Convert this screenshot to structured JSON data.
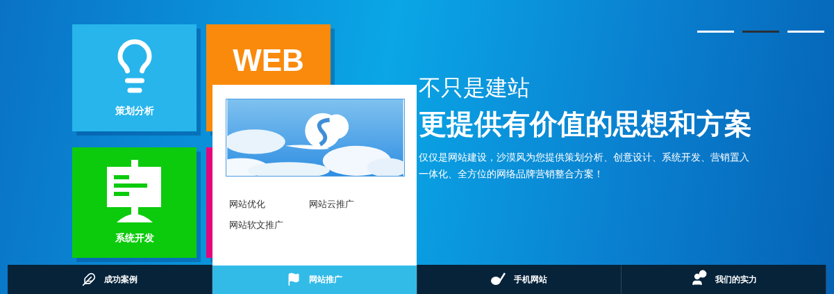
{
  "slider_indicators": [
    {
      "selected": false
    },
    {
      "selected": true
    },
    {
      "selected": false
    }
  ],
  "tiles": [
    {
      "kind": "bulb",
      "label": "策划分析",
      "color": "#27b5ec"
    },
    {
      "kind": "word",
      "label": "WEB",
      "color": "#f98a0c"
    },
    {
      "kind": "board",
      "label": "系统开发",
      "color": "#0ccb0c"
    },
    {
      "kind": "blank",
      "color": "#e4057d"
    }
  ],
  "popup": {
    "links": [
      "网站优化",
      "网站云推广",
      "网站软文推广"
    ]
  },
  "hero": {
    "title": "不只是建站",
    "headline": "更提供有价值的思想和方案",
    "description_lines": [
      "仅仅是网站建设，沙漠风为您提供策划分析、创意设计、系统开发、营销置入",
      "一体化、全方位的网络品牌营销整合方案！"
    ]
  },
  "nav": [
    {
      "kind": "feather",
      "label": "成功案例",
      "selected": false
    },
    {
      "kind": "flag",
      "label": "网站推广",
      "selected": true
    },
    {
      "kind": "mobile",
      "label": "手机网站",
      "selected": false
    },
    {
      "kind": "team",
      "label": "我们的实力",
      "selected": false
    }
  ]
}
